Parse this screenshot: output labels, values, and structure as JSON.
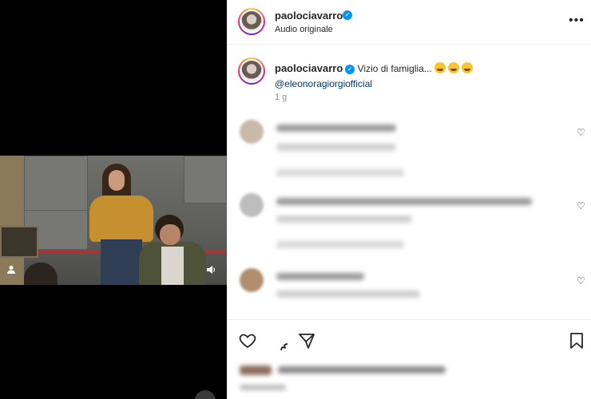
{
  "post": {
    "author": "paolociavarro",
    "audio": "Audio originale"
  },
  "caption": {
    "author": "paolociavarro",
    "text": "Vizio di famiglia...",
    "mention": "@eleonoragiorgiofficial",
    "time": "1 g"
  },
  "icons": {
    "more": "more-icon",
    "verified": "verified-badge-icon",
    "like": "heart-icon",
    "comment": "comment-icon",
    "share": "share-icon",
    "save": "bookmark-icon",
    "volume": "volume-icon",
    "user_tag": "user-tag-icon"
  },
  "colors": {
    "verified": "#0095f6",
    "mention": "#00376b",
    "muted": "#8e8e8e",
    "text": "#262626"
  }
}
